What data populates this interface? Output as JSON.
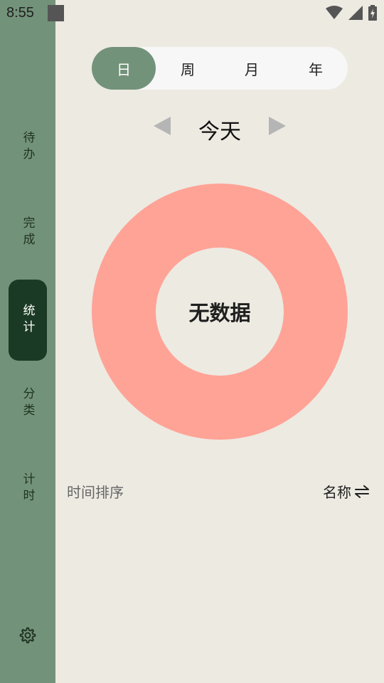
{
  "status_bar": {
    "time": "8:55",
    "icons": [
      "notification-square-icon",
      "wifi-icon",
      "cellular-signal-icon",
      "battery-icon"
    ]
  },
  "sidebar": {
    "items": [
      {
        "label": "待办",
        "active": false
      },
      {
        "label": "完成",
        "active": false
      },
      {
        "label": "统计",
        "active": true
      },
      {
        "label": "分类",
        "active": false
      },
      {
        "label": "计时",
        "active": false
      }
    ],
    "settings_icon": "gear-icon"
  },
  "period_tabs": [
    {
      "label": "日",
      "active": true
    },
    {
      "label": "周",
      "active": false
    },
    {
      "label": "月",
      "active": false
    },
    {
      "label": "年",
      "active": false
    }
  ],
  "period_nav": {
    "title": "今天",
    "prev_icon": "triangle-left-icon",
    "next_icon": "triangle-right-icon"
  },
  "chart": {
    "center_label": "无数据",
    "ring_color": "#ffa397"
  },
  "sort": {
    "left_label": "时间排序",
    "right_label": "名称",
    "right_icon": "swap-arrows-icon"
  },
  "colors": {
    "sidebar": "#73927a",
    "active_nav": "#1b3a25",
    "background": "#edeae2"
  }
}
